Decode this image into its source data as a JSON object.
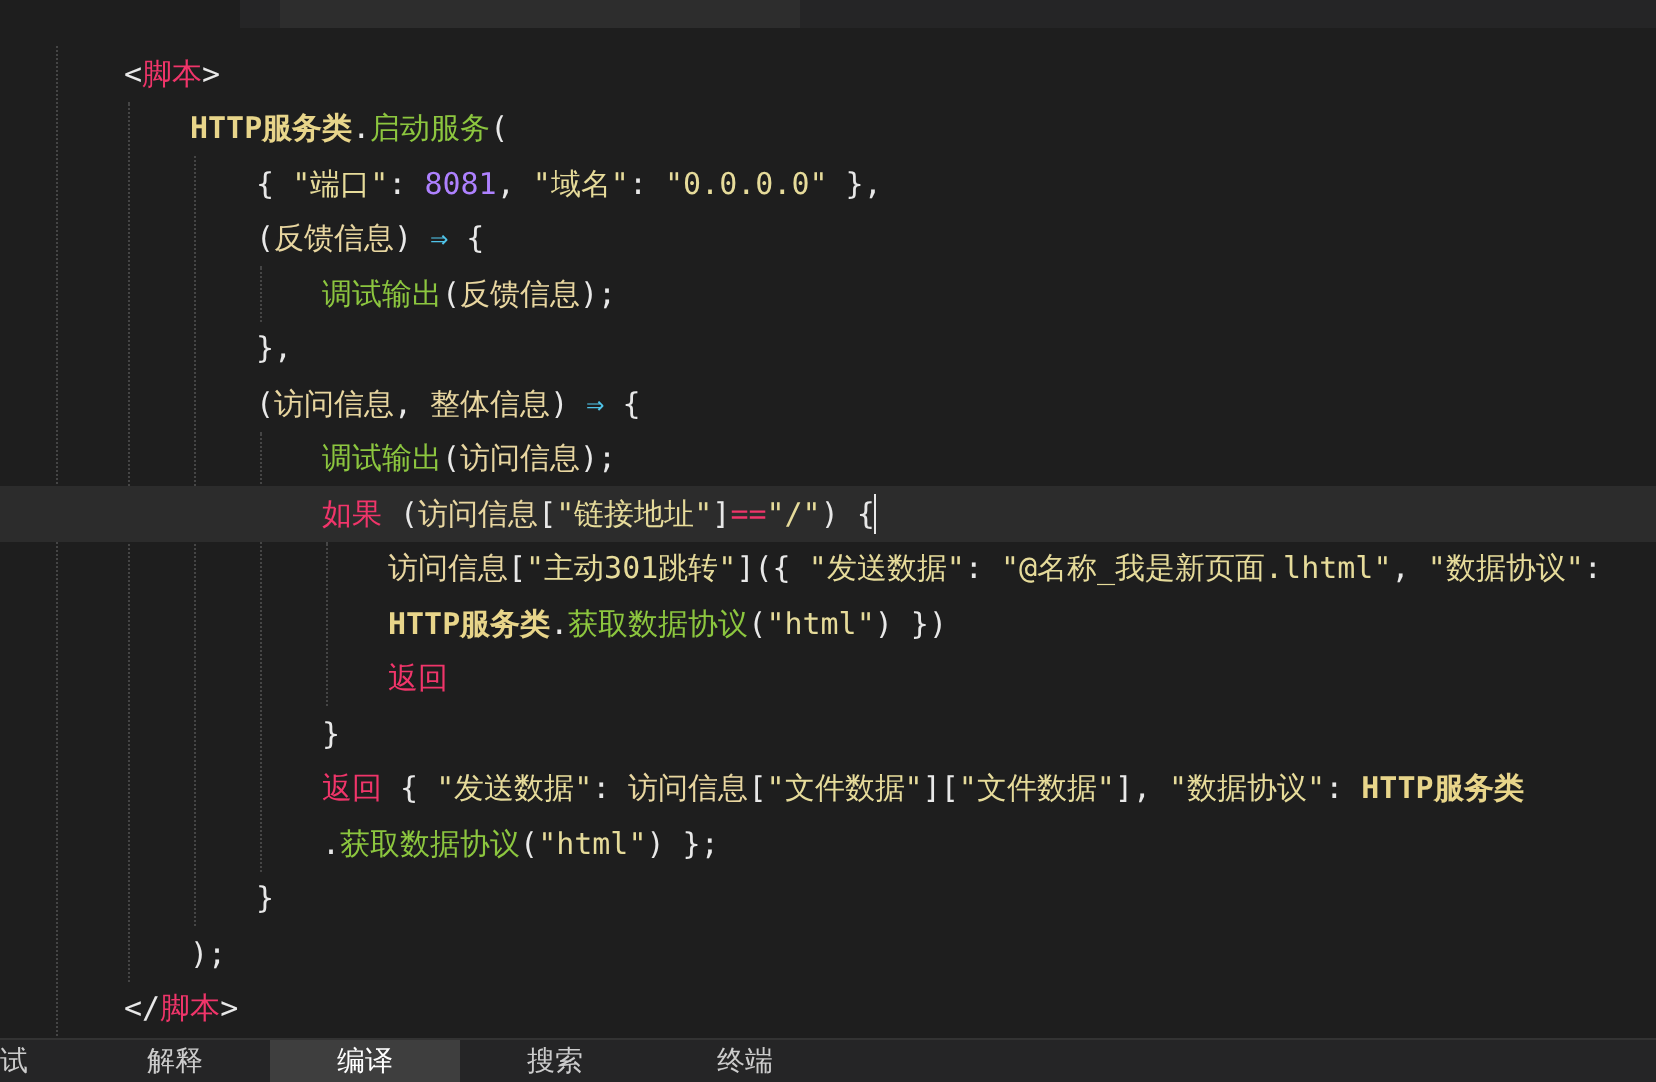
{
  "bottom_tabs": [
    {
      "label": "试",
      "selected": false
    },
    {
      "label": "解释",
      "selected": false
    },
    {
      "label": "编译",
      "selected": true
    },
    {
      "label": "搜索",
      "selected": false
    },
    {
      "label": "终端",
      "selected": false
    }
  ],
  "code": {
    "lines": [
      {
        "current": false,
        "tokens": [
          {
            "kind": "punct",
            "text": "<"
          },
          {
            "kind": "tag",
            "text": "脚本"
          },
          {
            "kind": "punct",
            "text": ">"
          }
        ],
        "children": [
          {
            "current": false,
            "tokens": [
              {
                "kind": "class",
                "text": "HTTP服务类"
              },
              {
                "kind": "punct",
                "text": "."
              },
              {
                "kind": "func",
                "text": "启动服务"
              },
              {
                "kind": "punct",
                "text": "("
              }
            ],
            "children": [
              {
                "current": false,
                "tokens": [
                  {
                    "kind": "punct",
                    "text": "{ "
                  },
                  {
                    "kind": "str",
                    "text": "\"端口\""
                  },
                  {
                    "kind": "punct",
                    "text": ": "
                  },
                  {
                    "kind": "num",
                    "text": "8081"
                  },
                  {
                    "kind": "punct",
                    "text": ", "
                  },
                  {
                    "kind": "str",
                    "text": "\"域名\""
                  },
                  {
                    "kind": "punct",
                    "text": ": "
                  },
                  {
                    "kind": "str",
                    "text": "\"0.0.0.0\""
                  },
                  {
                    "kind": "punct",
                    "text": " },"
                  }
                ]
              },
              {
                "current": false,
                "tokens": [
                  {
                    "kind": "punct",
                    "text": "("
                  },
                  {
                    "kind": "var",
                    "text": "反馈信息"
                  },
                  {
                    "kind": "punct",
                    "text": ") "
                  },
                  {
                    "kind": "arrow",
                    "text": "⇒"
                  },
                  {
                    "kind": "punct",
                    "text": " {"
                  }
                ],
                "children": [
                  {
                    "current": false,
                    "tokens": [
                      {
                        "kind": "func",
                        "text": "调试输出"
                      },
                      {
                        "kind": "punct",
                        "text": "("
                      },
                      {
                        "kind": "var",
                        "text": "反馈信息"
                      },
                      {
                        "kind": "punct",
                        "text": ");"
                      }
                    ]
                  }
                ]
              },
              {
                "current": false,
                "tokens": [
                  {
                    "kind": "punct",
                    "text": "},"
                  }
                ]
              },
              {
                "current": false,
                "tokens": [
                  {
                    "kind": "punct",
                    "text": "("
                  },
                  {
                    "kind": "var",
                    "text": "访问信息"
                  },
                  {
                    "kind": "punct",
                    "text": ", "
                  },
                  {
                    "kind": "var",
                    "text": "整体信息"
                  },
                  {
                    "kind": "punct",
                    "text": ") "
                  },
                  {
                    "kind": "arrow",
                    "text": "⇒"
                  },
                  {
                    "kind": "punct",
                    "text": " {"
                  }
                ],
                "children": [
                  {
                    "current": false,
                    "tokens": [
                      {
                        "kind": "func",
                        "text": "调试输出"
                      },
                      {
                        "kind": "punct",
                        "text": "("
                      },
                      {
                        "kind": "var",
                        "text": "访问信息"
                      },
                      {
                        "kind": "punct",
                        "text": ");"
                      }
                    ]
                  },
                  {
                    "current": true,
                    "tokens": [
                      {
                        "kind": "kw",
                        "text": "如果"
                      },
                      {
                        "kind": "punct",
                        "text": " ("
                      },
                      {
                        "kind": "var",
                        "text": "访问信息"
                      },
                      {
                        "kind": "punct",
                        "text": "["
                      },
                      {
                        "kind": "str",
                        "text": "\"链接地址\""
                      },
                      {
                        "kind": "punct",
                        "text": "]"
                      },
                      {
                        "kind": "kw",
                        "text": "=="
                      },
                      {
                        "kind": "str",
                        "text": "\"/\""
                      },
                      {
                        "kind": "punct",
                        "text": ") {"
                      }
                    ],
                    "children": [
                      {
                        "current": false,
                        "tokens": [
                          {
                            "kind": "var",
                            "text": "访问信息"
                          },
                          {
                            "kind": "punct",
                            "text": "["
                          },
                          {
                            "kind": "str",
                            "text": "\"主动301跳转\""
                          },
                          {
                            "kind": "punct",
                            "text": "]({ "
                          },
                          {
                            "kind": "str",
                            "text": "\"发送数据\""
                          },
                          {
                            "kind": "punct",
                            "text": ": "
                          },
                          {
                            "kind": "str",
                            "text": "\"@名称_我是新页面.lhtml\""
                          },
                          {
                            "kind": "punct",
                            "text": ", "
                          },
                          {
                            "kind": "str",
                            "text": "\"数据协议\""
                          },
                          {
                            "kind": "punct",
                            "text": ":"
                          }
                        ]
                      },
                      {
                        "current": false,
                        "tokens": [
                          {
                            "kind": "class",
                            "text": "HTTP服务类"
                          },
                          {
                            "kind": "punct",
                            "text": "."
                          },
                          {
                            "kind": "func",
                            "text": "获取数据协议"
                          },
                          {
                            "kind": "punct",
                            "text": "("
                          },
                          {
                            "kind": "str",
                            "text": "\"html\""
                          },
                          {
                            "kind": "punct",
                            "text": ") })"
                          }
                        ]
                      },
                      {
                        "current": false,
                        "tokens": [
                          {
                            "kind": "kw",
                            "text": "返回"
                          }
                        ]
                      }
                    ]
                  },
                  {
                    "current": false,
                    "tokens": [
                      {
                        "kind": "punct",
                        "text": "}"
                      }
                    ]
                  },
                  {
                    "current": false,
                    "tokens": [
                      {
                        "kind": "kw",
                        "text": "返回"
                      },
                      {
                        "kind": "punct",
                        "text": " { "
                      },
                      {
                        "kind": "str",
                        "text": "\"发送数据\""
                      },
                      {
                        "kind": "punct",
                        "text": ": "
                      },
                      {
                        "kind": "var",
                        "text": "访问信息"
                      },
                      {
                        "kind": "punct",
                        "text": "["
                      },
                      {
                        "kind": "str",
                        "text": "\"文件数据\""
                      },
                      {
                        "kind": "punct",
                        "text": "]["
                      },
                      {
                        "kind": "str",
                        "text": "\"文件数据\""
                      },
                      {
                        "kind": "punct",
                        "text": "], "
                      },
                      {
                        "kind": "str",
                        "text": "\"数据协议\""
                      },
                      {
                        "kind": "punct",
                        "text": ": "
                      },
                      {
                        "kind": "class",
                        "text": "HTTP服务类"
                      }
                    ]
                  },
                  {
                    "current": false,
                    "tokens": [
                      {
                        "kind": "punct",
                        "text": "."
                      },
                      {
                        "kind": "func",
                        "text": "获取数据协议"
                      },
                      {
                        "kind": "punct",
                        "text": "("
                      },
                      {
                        "kind": "str",
                        "text": "\"html\""
                      },
                      {
                        "kind": "punct",
                        "text": ") };"
                      }
                    ]
                  }
                ]
              },
              {
                "current": false,
                "tokens": [
                  {
                    "kind": "punct",
                    "text": "}"
                  }
                ]
              }
            ]
          },
          {
            "current": false,
            "tokens": [
              {
                "kind": "punct",
                "text": ");"
              }
            ]
          }
        ]
      },
      {
        "current": false,
        "tokens": [
          {
            "kind": "punct",
            "text": "</"
          },
          {
            "kind": "tag",
            "text": "脚本"
          },
          {
            "kind": "punct",
            "text": ">"
          }
        ]
      }
    ]
  }
}
